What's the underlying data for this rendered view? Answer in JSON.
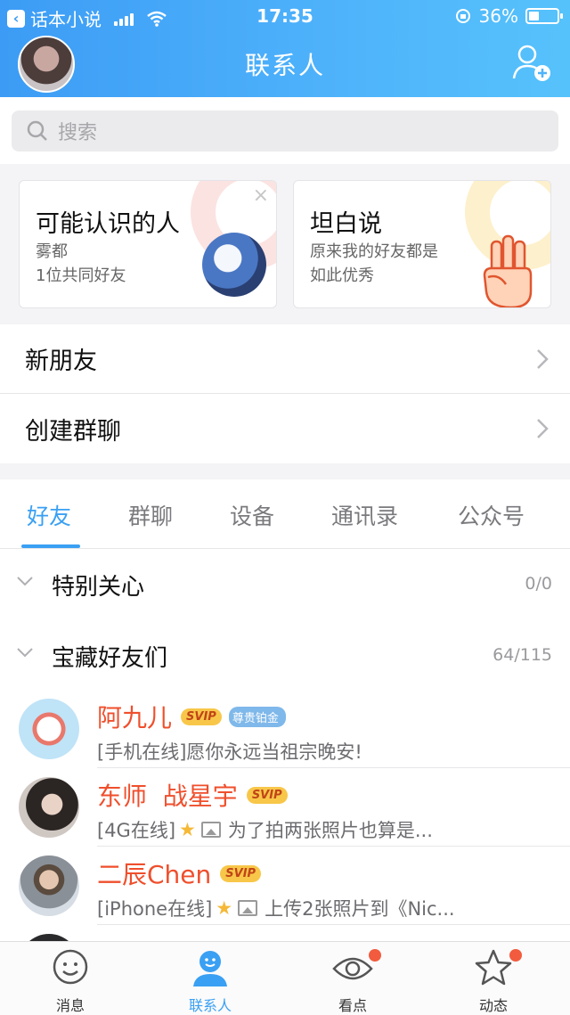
{
  "status_bar": {
    "back_app": "话本小说",
    "time": "17:35",
    "battery_percent": "36%",
    "battery_level": 0.36
  },
  "header": {
    "title": "联系人"
  },
  "search": {
    "placeholder": "搜索"
  },
  "cards": [
    {
      "title": "可能认识的人",
      "line1": "雾都",
      "line2": "1位共同好友",
      "close": "×"
    },
    {
      "title": "坦白说",
      "line1": "原来我的好友都是",
      "line2": "如此优秀"
    }
  ],
  "rows": {
    "new_friends": "新朋友",
    "create_group": "创建群聊"
  },
  "tabs": [
    "好友",
    "群聊",
    "设备",
    "通讯录",
    "公众号"
  ],
  "sections": [
    {
      "name": "特别关心",
      "count": "0/0"
    },
    {
      "name": "宝藏好友们",
      "count": "64/115"
    }
  ],
  "friends": [
    {
      "name": "阿九儿",
      "svip": "SVIP",
      "plat": "尊贵铂金",
      "status": "[手机在线]愿你永远当祖宗晚安!",
      "has_icons": false
    },
    {
      "name": "东师  战星宇",
      "svip": "SVIP",
      "status_prefix": "[4G在线]",
      "status_text": "为了拍两张照片也算是...",
      "has_icons": true
    },
    {
      "name": "二辰Chen",
      "svip": "SVIP",
      "status_prefix": "[iPhone在线]",
      "status_text": "上传2张照片到《Nic...",
      "has_icons": true
    }
  ],
  "tabbar": [
    {
      "label": "消息",
      "icon": "smile-icon"
    },
    {
      "label": "联系人",
      "icon": "contacts-icon"
    },
    {
      "label": "看点",
      "icon": "eye-icon"
    },
    {
      "label": "动态",
      "icon": "star-icon"
    }
  ],
  "colors": {
    "accent": "#3aa0f3",
    "name_red": "#ef4f2c",
    "badge_dot": "#f25b3d"
  }
}
